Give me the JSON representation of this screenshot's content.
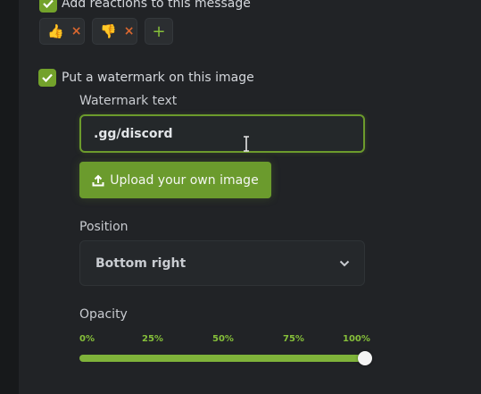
{
  "reactions": {
    "checkbox_label": "Add reactions to this message",
    "checked": true,
    "items": [
      {
        "emoji": "👍",
        "remove_icon": "×"
      },
      {
        "emoji": "👎",
        "remove_icon": "×"
      }
    ],
    "add_icon": "+"
  },
  "watermark": {
    "checkbox_label": "Put a watermark on this image",
    "checked": true,
    "text_label": "Watermark text",
    "text_value": ".gg/discord",
    "upload_label": "Upload your own image",
    "position_label": "Position",
    "position_value": "Bottom right",
    "opacity_label": "Opacity",
    "opacity_ticks": [
      "0%",
      "25%",
      "50%",
      "75%",
      "100%"
    ],
    "opacity_value": 1.0
  },
  "colors": {
    "accent": "#73a22b",
    "remove": "#d9672f"
  },
  "icons": {
    "check": "check-icon",
    "upload": "upload-icon",
    "dropdown": "chevron-down-icon",
    "cursor": "text-cursor-icon"
  }
}
